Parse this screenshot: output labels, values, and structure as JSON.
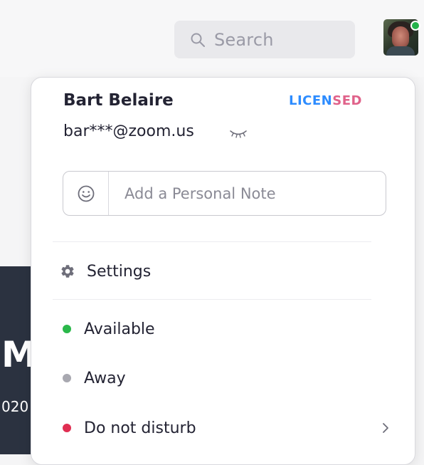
{
  "header": {
    "search": {
      "placeholder": "Search"
    }
  },
  "left_panel": {
    "big_text": "M",
    "small_text": "020"
  },
  "profile_menu": {
    "user_name": "Bart Belaire",
    "badge": {
      "part1": "LICEN",
      "part2": "SED"
    },
    "email": "bar***@zoom.us",
    "personal_note": {
      "placeholder": "Add a Personal Note"
    },
    "settings_label": "Settings",
    "statuses": [
      {
        "label": "Available",
        "color": "#2ab84a"
      },
      {
        "label": "Away",
        "color": "#a8a8b0"
      },
      {
        "label": "Do not disturb",
        "color": "#e02e52"
      }
    ]
  },
  "colors": {
    "accent_blue": "#2d8cff",
    "badge_pink": "#e0628a",
    "presence_green": "#24b24a"
  },
  "icons": [
    "search-icon",
    "eye-hidden-icon",
    "smiley-icon",
    "gear-icon",
    "chevron-right-icon"
  ]
}
